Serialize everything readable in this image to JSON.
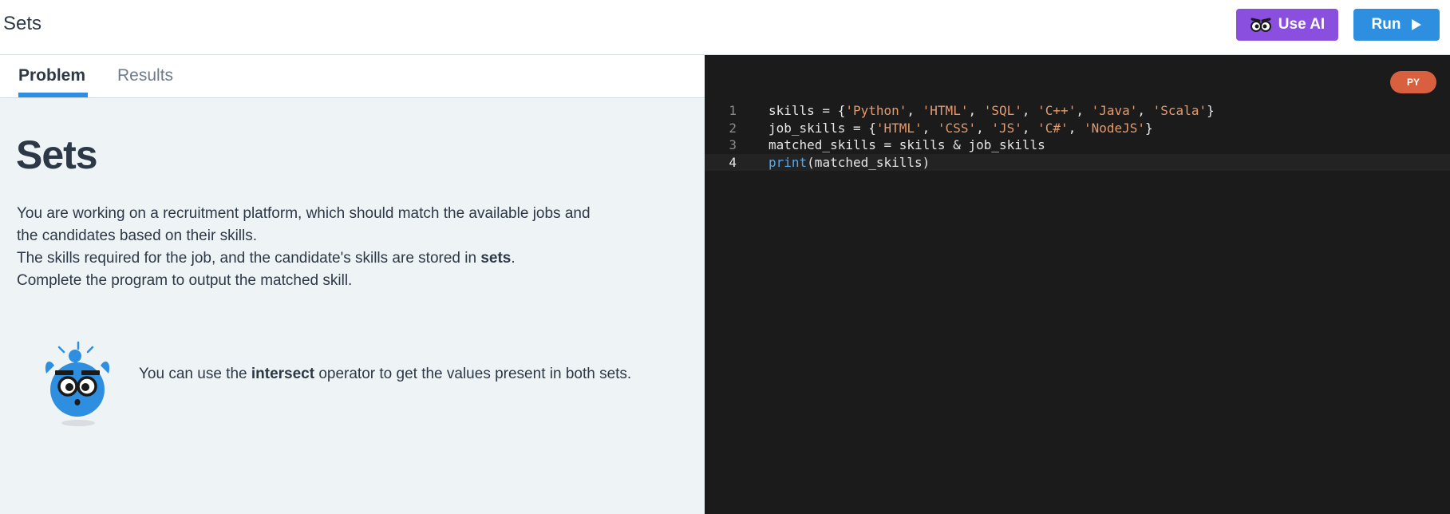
{
  "header": {
    "title": "Sets",
    "use_ai_label": "Use AI",
    "run_label": "Run"
  },
  "tabs": [
    {
      "label": "Problem",
      "active": true
    },
    {
      "label": "Results",
      "active": false
    }
  ],
  "problem": {
    "title": "Sets",
    "description": {
      "line1": "You are working on a recruitment platform, which should match the available jobs and the candidates based on their skills.",
      "line2_before": "The skills required for the job, and the candidate's skills are stored in ",
      "line2_bold": "sets",
      "line2_after": ".",
      "line3": "Complete the program to output the matched skill."
    },
    "hint": {
      "before": "You can use the ",
      "bold": "intersect",
      "after": " operator to get the values present in both sets."
    }
  },
  "editor": {
    "language_badge": "PY",
    "active_line": 4,
    "lines": [
      {
        "number": "1",
        "tokens": [
          [
            "skills = {",
            "p"
          ],
          [
            "'Python'",
            "s"
          ],
          [
            ", ",
            "p"
          ],
          [
            "'HTML'",
            "s"
          ],
          [
            ", ",
            "p"
          ],
          [
            "'SQL'",
            "s"
          ],
          [
            ", ",
            "p"
          ],
          [
            "'C++'",
            "s"
          ],
          [
            ", ",
            "p"
          ],
          [
            "'Java'",
            "s"
          ],
          [
            ", ",
            "p"
          ],
          [
            "'Scala'",
            "s"
          ],
          [
            "}",
            "p"
          ]
        ]
      },
      {
        "number": "2",
        "tokens": [
          [
            "job_skills = {",
            "p"
          ],
          [
            "'HTML'",
            "s"
          ],
          [
            ", ",
            "p"
          ],
          [
            "'CSS'",
            "s"
          ],
          [
            ", ",
            "p"
          ],
          [
            "'JS'",
            "s"
          ],
          [
            ", ",
            "p"
          ],
          [
            "'C#'",
            "s"
          ],
          [
            ", ",
            "p"
          ],
          [
            "'NodeJS'",
            "s"
          ],
          [
            "}",
            "p"
          ]
        ]
      },
      {
        "number": "3",
        "tokens": [
          [
            "matched_skills = skills & job_skills",
            "p"
          ]
        ]
      },
      {
        "number": "4",
        "tokens": [
          [
            "print",
            "k"
          ],
          [
            "(matched_skills)",
            "p"
          ]
        ]
      }
    ]
  },
  "colors": {
    "use_ai_button": "#8a4fdf",
    "run_button": "#2e8fe1",
    "editor_background": "#1b1b1b",
    "string_token": "#e59a6e",
    "keyword_token": "#5aa6e6",
    "language_badge": "#d8603f"
  },
  "icons": {
    "use_ai": "ai-face-icon",
    "run": "play-icon",
    "hint": "mascot-icon"
  }
}
